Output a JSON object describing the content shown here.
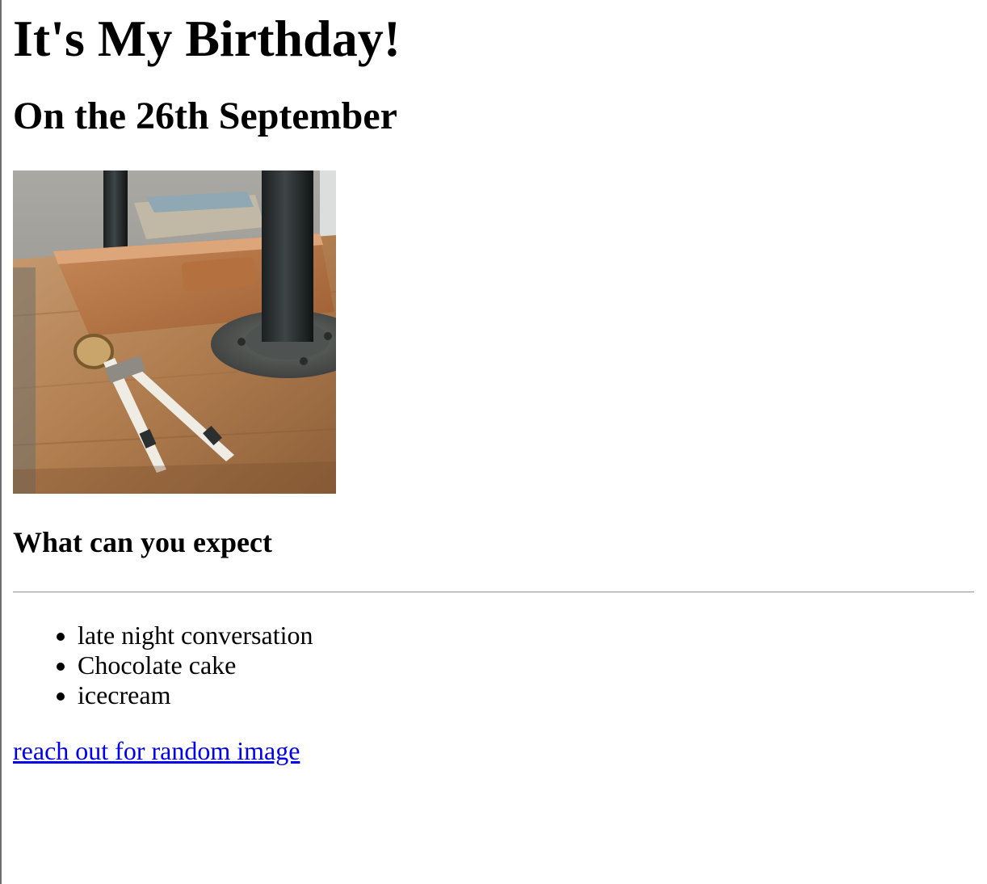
{
  "page": {
    "title": "It's My Birthday!",
    "subtitle": "On the 26th September",
    "section_heading": "What can you expect",
    "expectations": [
      "late night conversation",
      "Chocolate cake",
      "icecream"
    ],
    "link_text": "reach out for random image"
  },
  "colors": {
    "link": "#0000ee",
    "text": "#000000",
    "background": "#ffffff"
  }
}
